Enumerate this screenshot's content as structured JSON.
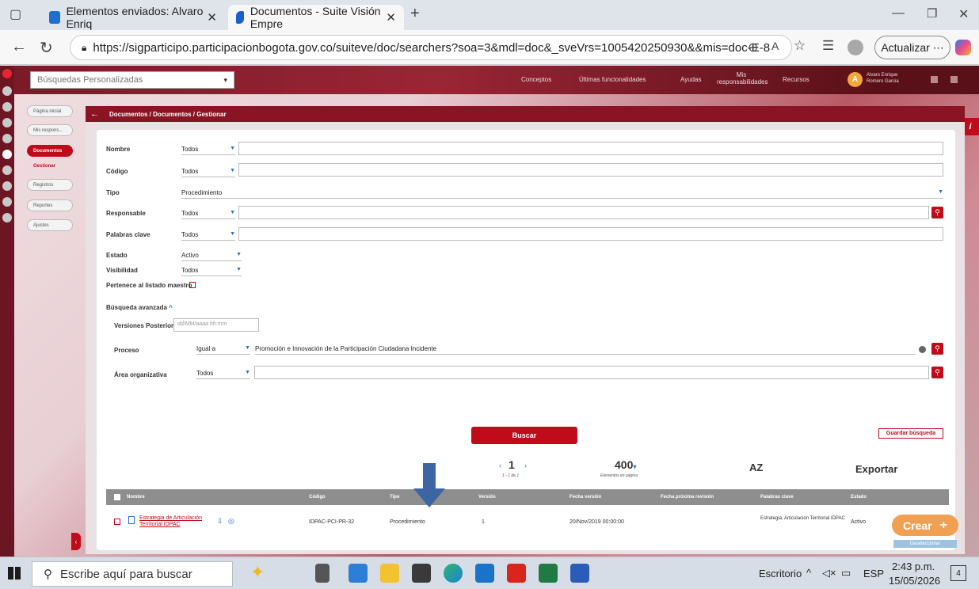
{
  "browser": {
    "tabs": [
      {
        "title": "Elementos enviados: Alvaro Enriq"
      },
      {
        "title": "Documentos - Suite Visión Empre"
      }
    ],
    "url": "https://sigparticipo.participacionbogota.gov.co/suiteve/doc/searchers?soa=3&mdl=doc&_sveVrs=1005420250930&&mis=doc-E-8",
    "update_label": "Actualizar"
  },
  "app": {
    "search_select": "Búsquedas Personalizadas",
    "topnav": [
      "Conceptos",
      "Últimas funcionalidades",
      "Ayudas",
      "Mis responsabilidades",
      "Recursos"
    ],
    "user": {
      "initial": "A",
      "name": "Alvaro Enrique Romero Garcia"
    },
    "sidebar": [
      "Página inicial",
      "Mis respons...",
      "Documentos",
      "Gestionar",
      "Registros",
      "Reportes",
      "Ajustes"
    ],
    "breadcrumb": "Documentos / Documentos / Gestionar",
    "form": {
      "nombre": {
        "label": "Nombre",
        "value": "Todos"
      },
      "codigo": {
        "label": "Código",
        "value": "Todos"
      },
      "tipo": {
        "label": "Tipo",
        "value": "Procedimiento"
      },
      "responsable": {
        "label": "Responsable",
        "value": "Todos"
      },
      "palabras": {
        "label": "Palabras clave",
        "value": "Todos"
      },
      "estado": {
        "label": "Estado",
        "value": "Activo"
      },
      "visibilidad": {
        "label": "Visibilidad",
        "value": "Todos"
      },
      "maestro": {
        "label": "Pertenece al listado maestro"
      },
      "avanzada": {
        "label": "Búsqueda avanzada"
      },
      "versiones": {
        "label": "Versiones Posteriores a la Fecha",
        "placeholder": "dd/MM/aaaa hh:mm"
      },
      "proceso": {
        "label": "Proceso",
        "op": "Igual a",
        "value": "Promoción e Innovación de la Participación Ciudadana Incidente"
      },
      "area": {
        "label": "Área organizativa",
        "value": "Todos"
      },
      "guardar": "Guardar búsqueda",
      "buscar": "Buscar"
    },
    "results": {
      "page": "1",
      "page_sub": "1 - 1 de 1",
      "per_page": "400",
      "per_page_label": "Elementos en página",
      "sort": "AZ",
      "export": "Exportar",
      "headers": [
        "Nombre",
        "Código",
        "Tipo",
        "Versión",
        "Fecha versión",
        "Fecha próxima revisión",
        "Palabras clave",
        "Estado"
      ],
      "row": {
        "nombre": "Estrategia de Articulación Territorial IDPAC",
        "codigo": "IDPAC-PCI-PR-32",
        "tipo": "Procedimiento",
        "version": "1",
        "fecha": "20/Nov/2019 00:00:00",
        "proxima": "",
        "palabras": "Estrategia, Articulación Territorial IDPAC",
        "estado": "Activo"
      },
      "crear": "Crear",
      "deselect": "Deseleccionar"
    }
  },
  "taskbar": {
    "search": "Escribe aquí para buscar",
    "desktop": "Escritorio",
    "lang": "ESP",
    "time": "2:43 p.m.",
    "date": "15/05/2026",
    "notif": "4"
  },
  "colors": {
    "brand": "#c00b1b",
    "header": "#8a1424"
  }
}
